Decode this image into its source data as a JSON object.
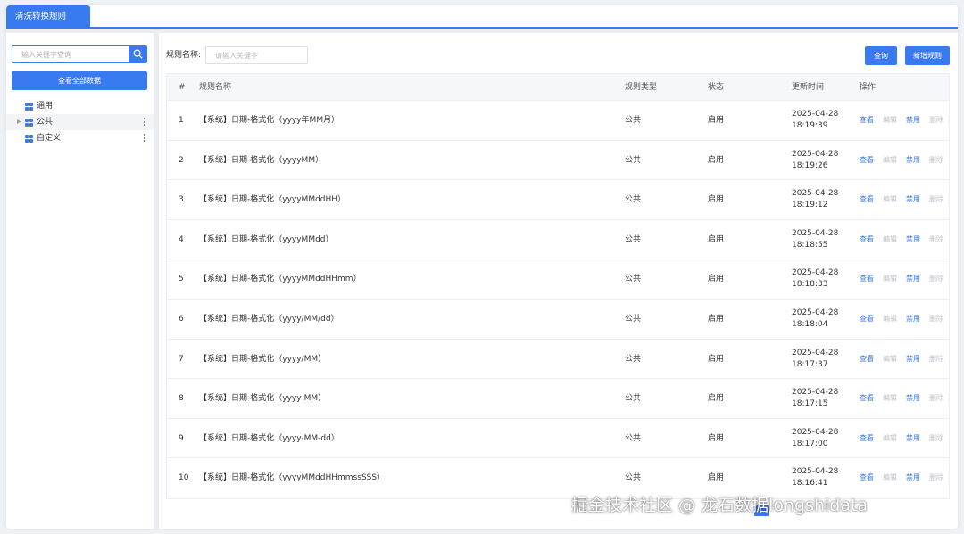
{
  "tab": {
    "label": "清洗转换规则"
  },
  "sidebar": {
    "search_placeholder": "输入关键字查询",
    "view_all_label": "查看全部数据",
    "tree": [
      {
        "label": "通用"
      },
      {
        "label": "公共"
      },
      {
        "label": "自定义"
      }
    ]
  },
  "filter": {
    "label": "规则名称:",
    "placeholder": "请输入关键字",
    "query_label": "查询",
    "new_label": "新增规则"
  },
  "table": {
    "headers": {
      "idx": "#",
      "name": "规则名称",
      "type": "规则类型",
      "status": "状态",
      "time": "更新时间",
      "ops": "操作"
    },
    "ops": {
      "view": "查看",
      "edit": "编辑",
      "disable": "禁用",
      "delete": "删除"
    },
    "rows": [
      {
        "idx": "1",
        "name": "【系统】日期-格式化（yyyy年MM月）",
        "type": "公共",
        "status": "启用",
        "time": "2025-04-28\n18:19:39"
      },
      {
        "idx": "2",
        "name": "【系统】日期-格式化（yyyyMM）",
        "type": "公共",
        "status": "启用",
        "time": "2025-04-28\n18:19:26"
      },
      {
        "idx": "3",
        "name": "【系统】日期-格式化（yyyyMMddHH）",
        "type": "公共",
        "status": "启用",
        "time": "2025-04-28\n18:19:12"
      },
      {
        "idx": "4",
        "name": "【系统】日期-格式化（yyyyMMdd）",
        "type": "公共",
        "status": "启用",
        "time": "2025-04-28\n18:18:55"
      },
      {
        "idx": "5",
        "name": "【系统】日期-格式化（yyyyMMddHHmm）",
        "type": "公共",
        "status": "启用",
        "time": "2025-04-28\n18:18:33"
      },
      {
        "idx": "6",
        "name": "【系统】日期-格式化（yyyy/MM/dd）",
        "type": "公共",
        "status": "启用",
        "time": "2025-04-28\n18:18:04"
      },
      {
        "idx": "7",
        "name": "【系统】日期-格式化（yyyy/MM）",
        "type": "公共",
        "status": "启用",
        "time": "2025-04-28\n18:17:37"
      },
      {
        "idx": "8",
        "name": "【系统】日期-格式化（yyyy-MM）",
        "type": "公共",
        "status": "启用",
        "time": "2025-04-28\n18:17:15"
      },
      {
        "idx": "9",
        "name": "【系统】日期-格式化（yyyy-MM-dd）",
        "type": "公共",
        "status": "启用",
        "time": "2025-04-28\n18:17:00"
      },
      {
        "idx": "10",
        "name": "【系统】日期-格式化（yyyyMMddHHmmssSSS）",
        "type": "公共",
        "status": "启用",
        "time": "2025-04-28\n18:16:41"
      }
    ]
  },
  "watermark": "掘金技术社区 @ 龙石数据longshidata",
  "colors": {
    "accent": "#3a7af0",
    "disabled": "#c0c4cc"
  }
}
